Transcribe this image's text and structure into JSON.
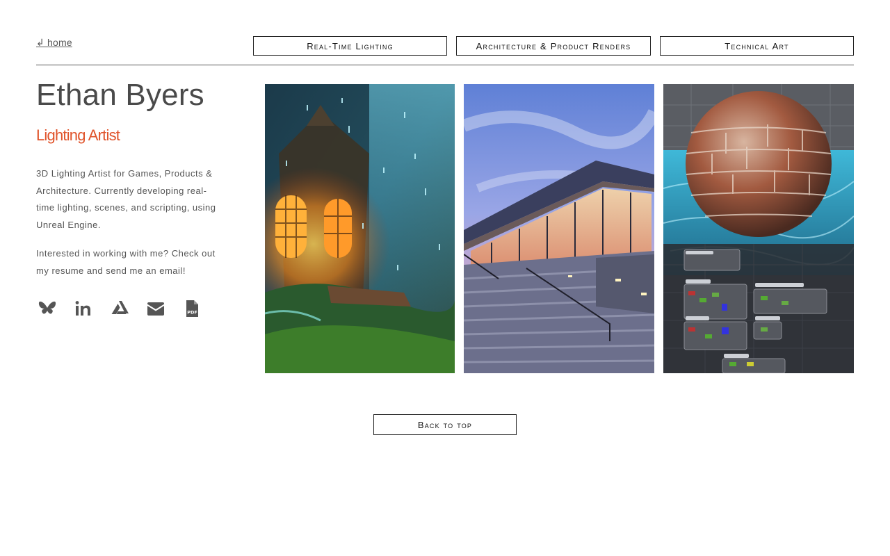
{
  "nav": {
    "home_label": "↲ home",
    "categories": [
      "Real-Time Lighting",
      "Architecture & Product Renders",
      "Technical Art"
    ]
  },
  "profile": {
    "name": "Ethan Byers",
    "role": "Lighting Artist",
    "bio": [
      "3D Lighting Artist for Games, Products & Architecture. Currently developing real-time lighting, scenes, and scripting, using Unreal Engine.",
      "Interested in working with me? Check out my resume and send me an email!"
    ]
  },
  "socials": [
    {
      "icon": "bluesky-icon"
    },
    {
      "icon": "linkedin-icon"
    },
    {
      "icon": "artstation-icon"
    },
    {
      "icon": "envelope-icon"
    },
    {
      "icon": "pdf-resume-icon",
      "text": "PDF"
    }
  ],
  "gallery": [
    {
      "name": "fantasy-hut-lighting-render"
    },
    {
      "name": "modern-pavilion-stairs-render"
    },
    {
      "name": "brick-sphere-water-material-graph"
    }
  ],
  "footer": {
    "back_to_top_label": "Back to top"
  },
  "colors": {
    "accent": "#e0532a",
    "text": "#4a4a4a",
    "icon": "#555555"
  }
}
